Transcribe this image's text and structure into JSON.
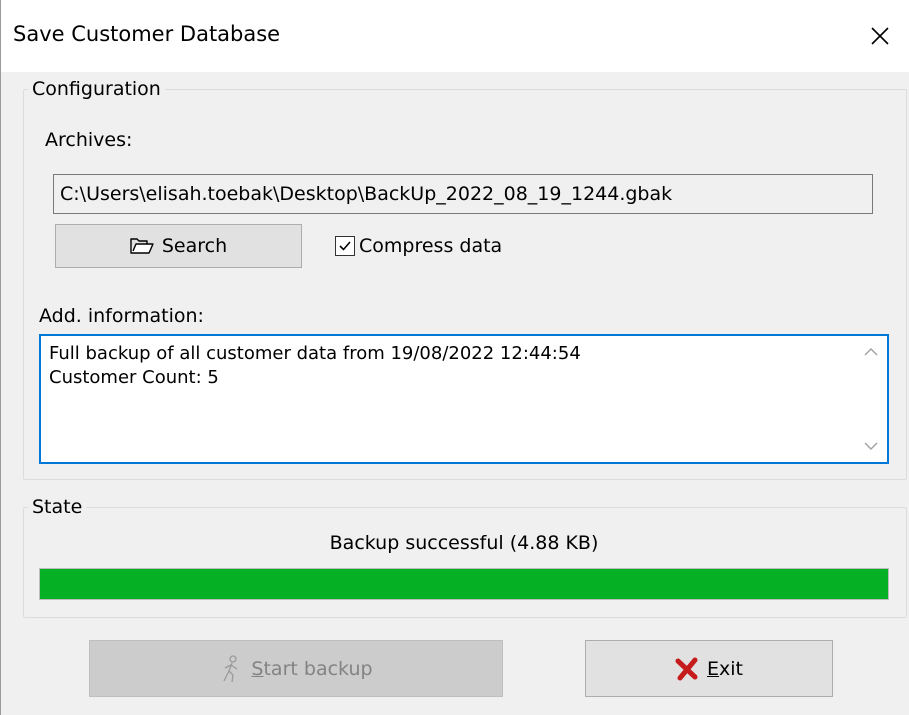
{
  "window": {
    "title": "Save Customer Database",
    "close_icon": "close-icon"
  },
  "configuration": {
    "group_label": "Configuration",
    "archives_label": "Archives:",
    "archive_path": "C:\\Users\\elisah.toebak\\Desktop\\BackUp_2022_08_19_1244.gbak",
    "search_button": {
      "label": "Search",
      "icon": "folder-open-icon"
    },
    "compress_data": {
      "label": "Compress data",
      "checked": true
    },
    "add_info_label": "Add. information:",
    "add_info_lines": [
      "Full backup of all customer data from 19/08/2022 12:44:54",
      "Customer Count: 5"
    ]
  },
  "state": {
    "group_label": "State",
    "status_text": "Backup successful (4.88 KB)",
    "progress_fraction": 1.0,
    "progress_color": "#06b025"
  },
  "buttons": {
    "start_backup": {
      "label_accel": "S",
      "label_rest": "tart backup",
      "icon": "walking-person-icon",
      "enabled": false
    },
    "exit": {
      "label_accel": "E",
      "label_rest": "xit",
      "icon": "red-x-icon"
    }
  }
}
